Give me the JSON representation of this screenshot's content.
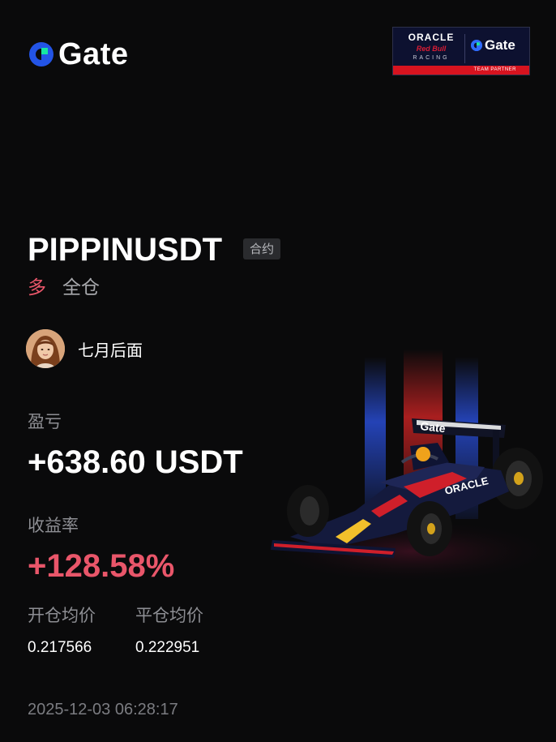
{
  "brand": {
    "name": "Gate",
    "icon": "gate-logo-icon"
  },
  "partner": {
    "oracle": "ORACLE",
    "redbull": "Red Bull",
    "racing": "RACING",
    "gate": "Gate",
    "strip": "TEAM PARTNER"
  },
  "trade": {
    "symbol": "PIPPINUSDT",
    "contract_tag": "合约",
    "side": "多",
    "margin_mode": "全仓"
  },
  "user": {
    "name": "七月后面",
    "avatar_icon": "user-avatar"
  },
  "stats": {
    "pnl_label": "盈亏",
    "pnl_value": "+638.60 USDT",
    "roi_label": "收益率",
    "roi_value": "+128.58%",
    "open_price_label": "开仓均价",
    "open_price_value": "0.217566",
    "close_price_label": "平仓均价",
    "close_price_value": "0.222951"
  },
  "timestamp": "2025-12-03 06:28:17",
  "colors": {
    "background": "#0a0a0b",
    "accent_long": "#e9566a",
    "brand_blue": "#2354e6",
    "brand_green": "#17e6a1",
    "muted_text": "#8d8e93"
  }
}
